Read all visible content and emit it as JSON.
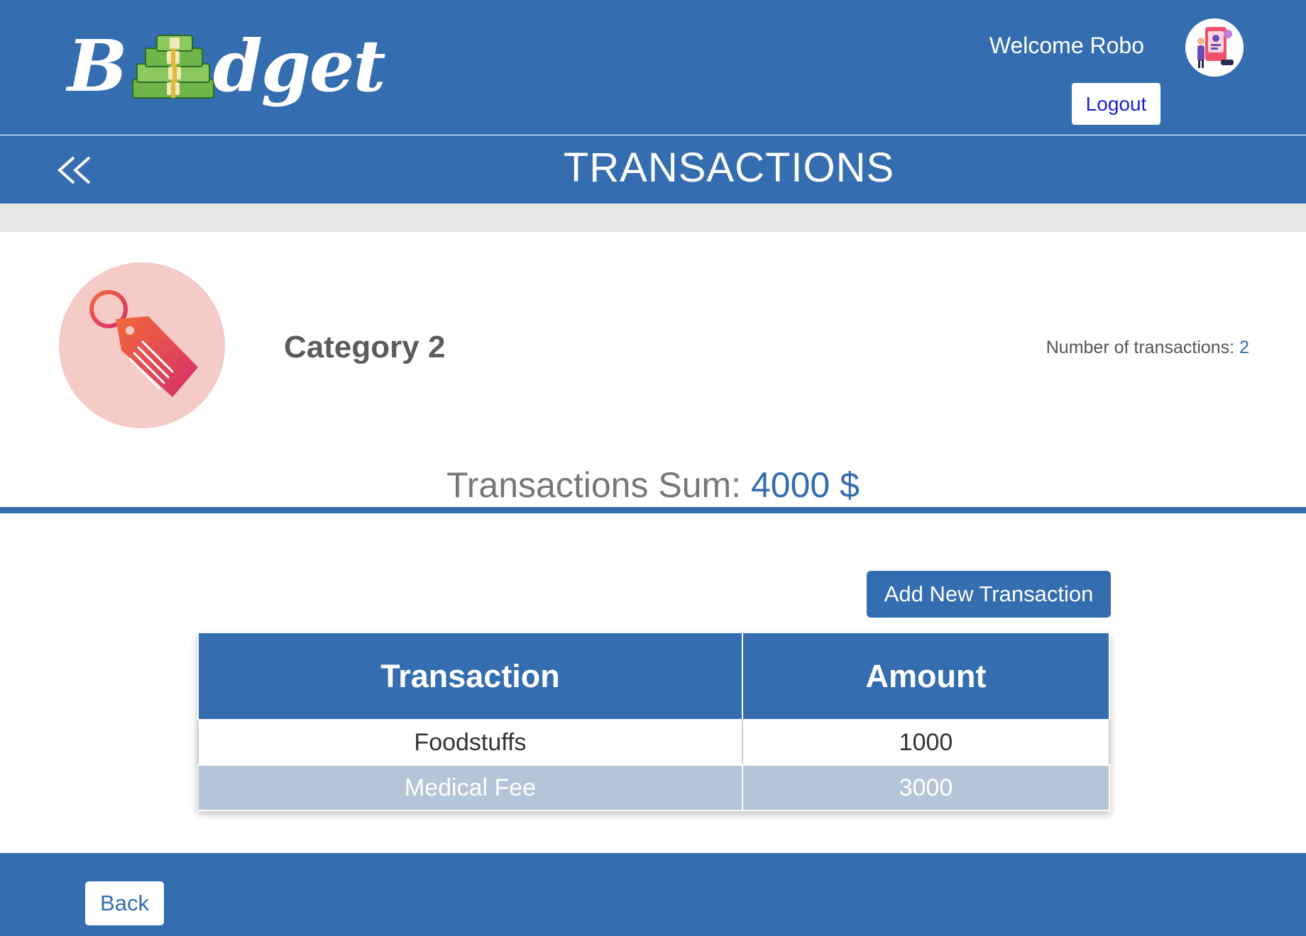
{
  "header": {
    "logo": {
      "first": "B",
      "rest": "dget"
    },
    "welcome": "Welcome Robo",
    "logout_label": "Logout"
  },
  "titlebar": {
    "title": "TRANSACTIONS"
  },
  "category": {
    "name": "Category 2",
    "count_label": "Number of transactions:",
    "count": "2",
    "icon": "price-tag-icon"
  },
  "summary": {
    "label": "Transactions Sum:",
    "value": "4000 $"
  },
  "actions": {
    "add_label": "Add New Transaction"
  },
  "table": {
    "headers": [
      "Transaction",
      "Amount"
    ],
    "rows": [
      {
        "name": "Foodstuffs",
        "amount": "1000"
      },
      {
        "name": "Medical Fee",
        "amount": "3000"
      }
    ]
  },
  "footer": {
    "back_label": "Back"
  },
  "colors": {
    "primary": "#346db0",
    "row_alt": "#b5c4d7",
    "category_bg": "#f5cbc8"
  }
}
